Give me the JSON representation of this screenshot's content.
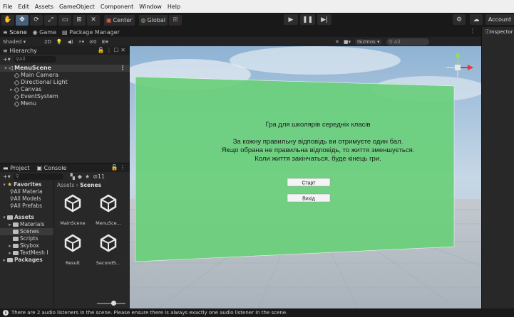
{
  "menu": [
    "File",
    "Edit",
    "Assets",
    "GameObject",
    "Component",
    "Window",
    "Help"
  ],
  "toolbar": {
    "pivot_label": "Center",
    "space_label": "Global",
    "account_label": "Account"
  },
  "tabs": {
    "scene": "Scene",
    "game": "Game",
    "package_manager": "Package Manager",
    "inspector": "Inspector"
  },
  "scene_toolbar": {
    "shading": "Shaded",
    "mode_2d": "2D",
    "gizmos": "Gizmos",
    "search_placeholder": "All"
  },
  "hierarchy": {
    "title": "Hierarchy",
    "search_placeholder": "All",
    "scene_name": "MenuScene",
    "items": [
      "Main Camera",
      "Directional Light",
      "Canvas",
      "EventSystem",
      "Menu"
    ]
  },
  "project": {
    "tab_project": "Project",
    "tab_console": "Console",
    "hidden_count": "11",
    "favorites_label": "Favorites",
    "favorites": [
      "All Materia",
      "All Models",
      "All Prefabs"
    ],
    "assets_label": "Assets",
    "asset_folders": [
      "Materials",
      "Scenes",
      "Scripts",
      "Skybox",
      "TextMesh I"
    ],
    "packages_label": "Packages",
    "breadcrumb_root": "Assets",
    "breadcrumb_current": "Scenes",
    "scene_assets": [
      "MainScene",
      "MenuSce...",
      "Result",
      "SecondS..."
    ]
  },
  "game_ui": {
    "title": "Гра для школярів середніх класів",
    "line1": "За кожну правильну відповідь ви отримуєте один бал.",
    "line2": "Якщо обрана не правильна відповідь, то життя зменшується.",
    "line3": "Коли життя закінчаться, буде кінець гри.",
    "start_button": "Старт",
    "exit_button": "Вихід"
  },
  "status": {
    "message": "There are 2 audio listeners in the scene. Please ensure there is always exactly one audio listener in the scene."
  },
  "colors": {
    "canvas_green": "#69cf7a",
    "sky": "#a9c4dc",
    "ground": "#bfc6cd",
    "gizmo_y": "#8ee05a",
    "gizmo_x": "#e0383c"
  }
}
